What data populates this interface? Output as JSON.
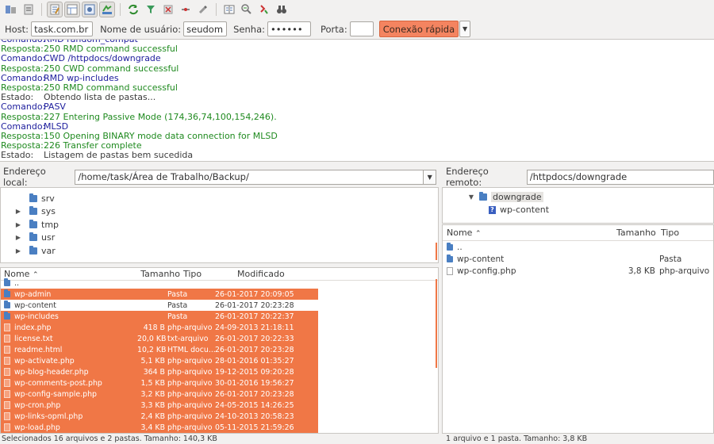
{
  "toolbar": {
    "icons": [
      "site-manager-icon",
      "process-queue-icon",
      "toggle-log-icon",
      "toggle-local-tree-icon",
      "toggle-remote-tree-icon",
      "refresh-icon",
      "filter-icon",
      "cancel-icon",
      "disconnect-icon",
      "reconnect-icon",
      "compare-icon",
      "sync-browse-icon",
      "search-icon",
      "binoculars-icon"
    ]
  },
  "quickconnect": {
    "host_label": "Host:",
    "host_value": "task.com.br",
    "user_label": "Nome de usuário:",
    "user_value": "seudominio",
    "pass_label": "Senha:",
    "pass_value": "••••••",
    "port_label": "Porta:",
    "port_value": "",
    "connect_label": "Conexão rápida"
  },
  "log": [
    {
      "type": "Comando:",
      "text": "RMD random_compat",
      "kind": "cmd"
    },
    {
      "type": "Resposta:",
      "text": "250 RMD command successful",
      "kind": "resp"
    },
    {
      "type": "Comando:",
      "text": "CWD /httpdocs/downgrade",
      "kind": "cmd"
    },
    {
      "type": "Resposta:",
      "text": "250 CWD command successful",
      "kind": "resp"
    },
    {
      "type": "Comando:",
      "text": "RMD wp-includes",
      "kind": "cmd"
    },
    {
      "type": "Resposta:",
      "text": "250 RMD command successful",
      "kind": "resp"
    },
    {
      "type": "Estado:",
      "text": "Obtendo lista de pastas...",
      "kind": "status"
    },
    {
      "type": "Comando:",
      "text": "PASV",
      "kind": "cmd"
    },
    {
      "type": "Resposta:",
      "text": "227 Entering Passive Mode (174,36,74,100,154,246).",
      "kind": "resp"
    },
    {
      "type": "Comando:",
      "text": "MLSD",
      "kind": "cmd"
    },
    {
      "type": "Resposta:",
      "text": "150 Opening BINARY mode data connection for MLSD",
      "kind": "resp"
    },
    {
      "type": "Resposta:",
      "text": "226 Transfer complete",
      "kind": "resp"
    },
    {
      "type": "Estado:",
      "text": "Listagem de pastas bem sucedida",
      "kind": "status"
    }
  ],
  "local": {
    "address_label": "Endereço local:",
    "address_value": "/home/task/Área de Trabalho/Backup/",
    "tree": [
      {
        "name": "srv",
        "expandable": false
      },
      {
        "name": "sys",
        "expandable": true
      },
      {
        "name": "tmp",
        "expandable": true
      },
      {
        "name": "usr",
        "expandable": true
      },
      {
        "name": "var",
        "expandable": true
      }
    ],
    "columns": {
      "name": "Nome",
      "size": "Tamanho",
      "type": "Tipo",
      "modified": "Modificado"
    },
    "files": [
      {
        "name": "..",
        "size": "",
        "type": "",
        "modified": "",
        "folder": true,
        "selected": false
      },
      {
        "name": "wp-admin",
        "size": "",
        "type": "Pasta",
        "modified": "26-01-2017 20:09:05",
        "folder": true,
        "selected": true
      },
      {
        "name": "wp-content",
        "size": "",
        "type": "Pasta",
        "modified": "26-01-2017 20:23:28",
        "folder": true,
        "selected": false
      },
      {
        "name": "wp-includes",
        "size": "",
        "type": "Pasta",
        "modified": "26-01-2017 20:22:37",
        "folder": true,
        "selected": true
      },
      {
        "name": "index.php",
        "size": "418 B",
        "type": "php-arquivo",
        "modified": "24-09-2013 21:18:11",
        "folder": false,
        "selected": true
      },
      {
        "name": "license.txt",
        "size": "20,0 KB",
        "type": "txt-arquivo",
        "modified": "26-01-2017 20:22:33",
        "folder": false,
        "selected": true
      },
      {
        "name": "readme.html",
        "size": "10,2 KB",
        "type": "HTML docu...",
        "modified": "26-01-2017 20:23:28",
        "folder": false,
        "selected": true
      },
      {
        "name": "wp-activate.php",
        "size": "5,1 KB",
        "type": "php-arquivo",
        "modified": "28-01-2016 01:35:27",
        "folder": false,
        "selected": true
      },
      {
        "name": "wp-blog-header.php",
        "size": "364 B",
        "type": "php-arquivo",
        "modified": "19-12-2015 09:20:28",
        "folder": false,
        "selected": true
      },
      {
        "name": "wp-comments-post.php",
        "size": "1,5 KB",
        "type": "php-arquivo",
        "modified": "30-01-2016 19:56:27",
        "folder": false,
        "selected": true
      },
      {
        "name": "wp-config-sample.php",
        "size": "3,2 KB",
        "type": "php-arquivo",
        "modified": "26-01-2017 20:23:28",
        "folder": false,
        "selected": true
      },
      {
        "name": "wp-cron.php",
        "size": "3,3 KB",
        "type": "php-arquivo",
        "modified": "24-05-2015 14:26:25",
        "folder": false,
        "selected": true
      },
      {
        "name": "wp-links-opml.php",
        "size": "2,4 KB",
        "type": "php-arquivo",
        "modified": "24-10-2013 20:58:23",
        "folder": false,
        "selected": true
      },
      {
        "name": "wp-load.php",
        "size": "3,4 KB",
        "type": "php-arquivo",
        "modified": "05-11-2015 21:59:26",
        "folder": false,
        "selected": true
      }
    ],
    "status": "Selecionados 16 arquivos e 2 pastas. Tamanho: 140,3 KB"
  },
  "remote": {
    "address_label": "Endereço remoto:",
    "address_value": "/httpdocs/downgrade",
    "tree": [
      {
        "name": "downgrade",
        "expanded": true,
        "unknown": false
      },
      {
        "name": "wp-content",
        "expanded": false,
        "unknown": true
      }
    ],
    "columns": {
      "name": "Nome",
      "size": "Tamanho",
      "type": "Tipo"
    },
    "files": [
      {
        "name": "..",
        "size": "",
        "type": "",
        "folder": true
      },
      {
        "name": "wp-content",
        "size": "",
        "type": "Pasta",
        "folder": true
      },
      {
        "name": "wp-config.php",
        "size": "3,8 KB",
        "type": "php-arquivo",
        "folder": false
      }
    ],
    "status": "1 arquivo e 1 pasta. Tamanho: 3,8 KB"
  },
  "colors": {
    "accent": "#f07746",
    "command": "#1c1c9c",
    "response": "#1f8a1f"
  }
}
